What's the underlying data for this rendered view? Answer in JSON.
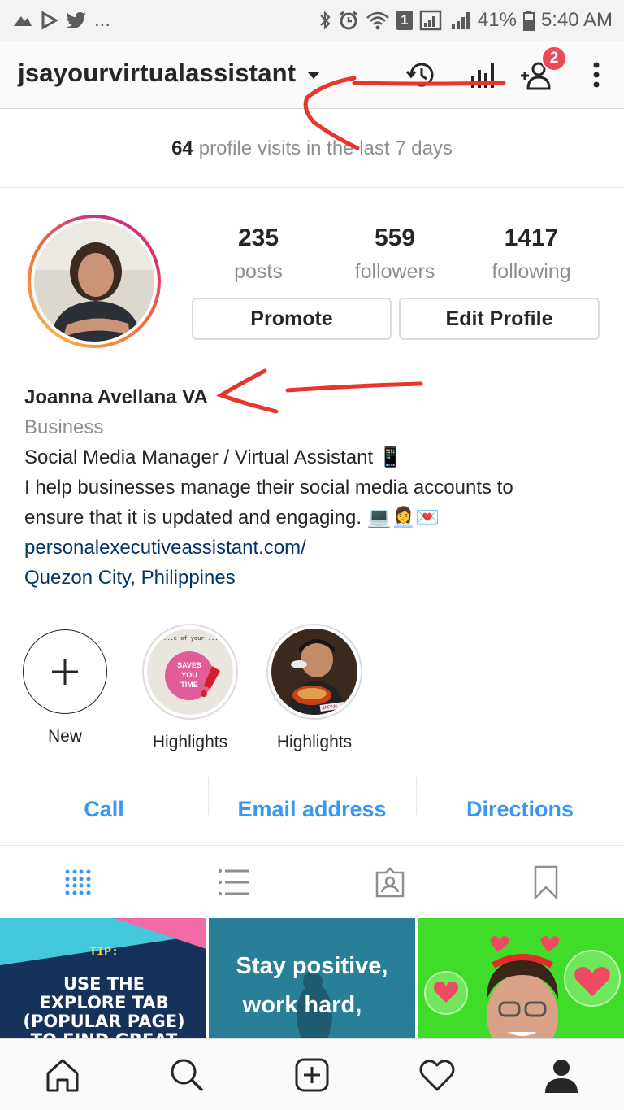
{
  "status_bar": {
    "left_extra": "...",
    "battery": "41%",
    "time": "5:40 AM",
    "sim_badge": "1"
  },
  "header": {
    "username": "jsayourvirtualassistant",
    "notification_count": "2"
  },
  "visits": {
    "count": "64",
    "text": "profile visits in the last 7 days"
  },
  "stats": [
    {
      "value": "235",
      "label": "posts"
    },
    {
      "value": "559",
      "label": "followers"
    },
    {
      "value": "1417",
      "label": "following"
    }
  ],
  "buttons": {
    "promote": "Promote",
    "edit_profile": "Edit Profile"
  },
  "bio": {
    "name": "Joanna Avellana VA",
    "category": "Business",
    "line1": "Social Media Manager / Virtual Assistant 📱",
    "line2": "I help businesses manage their social media accounts to",
    "line3": "ensure that it is updated and engaging. 💻👩‍💼💌",
    "website": "personalexecutiveassistant.com/",
    "location": "Quezon City, Philippines"
  },
  "highlights": [
    {
      "label": "New"
    },
    {
      "label": "Highlights",
      "text": "SAVES YOU TIME",
      "caption": "...e of your ...roductive time per day."
    },
    {
      "label": "Highlights",
      "text": "JAPAN"
    }
  ],
  "actions": {
    "call": "Call",
    "email": "Email address",
    "directions": "Directions"
  },
  "grid": {
    "post1_tip": "TIP:",
    "post1_line1": "USE THE",
    "post1_line2": "EXPLORE TAB",
    "post1_line3": "(POPULAR PAGE)",
    "post1_line4": "TO FIND GREAT",
    "post2_line1": "Stay positive,",
    "post2_line2": "work hard,"
  },
  "colors": {
    "accent_blue": "#3897f0",
    "link_blue": "#003569",
    "badge_red": "#ed4956",
    "annotation_red": "#e8362c"
  }
}
